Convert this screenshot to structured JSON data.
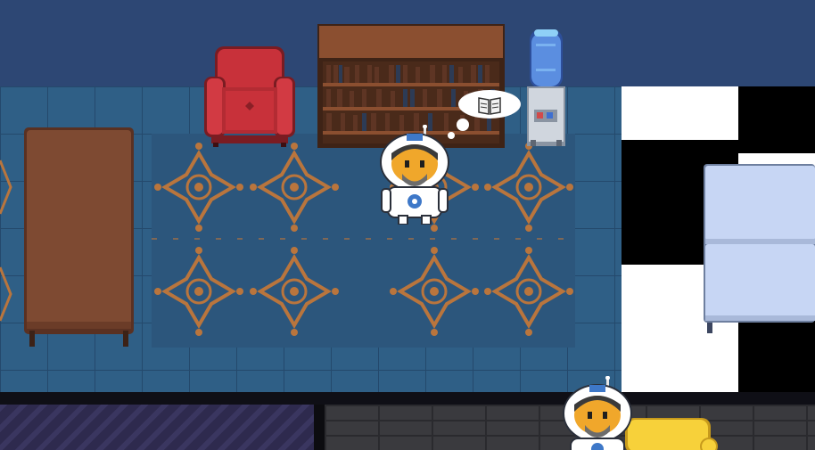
{
  "scene": {
    "title": "",
    "rooms": [
      "blue-tiled-lounge",
      "checkered-room",
      "purple-carpet-hall",
      "dark-wood-floor"
    ]
  },
  "colors": {
    "wall": "#2d4774",
    "floor_tile": "#2f5f86",
    "rug_pattern": "#b9753d",
    "armchair": "#c8313a",
    "table_wood": "#7e4a32",
    "bookshelf_wood": "#6b3b24",
    "water_jug": "#5b8ee0",
    "desk_top": "#c7d6f4",
    "sofa": "#f7d13a"
  },
  "objects": {
    "table": "long-wooden-table",
    "armchair": "red-armchair",
    "bookshelf": "wooden-bookshelf",
    "water_cooler": "water-cooler",
    "desk": "light-blue-desk",
    "sofa": "yellow-sofa"
  },
  "players": [
    {
      "name": "player-astronaut",
      "thought_icon": "book-icon",
      "status": "thinking"
    },
    {
      "name": "other-astronaut",
      "thought_icon": "",
      "status": "idle"
    }
  ]
}
